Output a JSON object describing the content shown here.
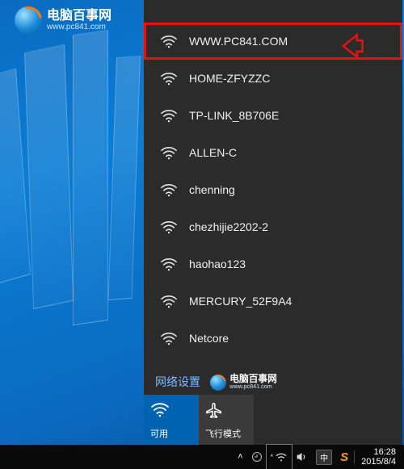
{
  "watermark": {
    "brand_cn": "电脑百事网",
    "brand_url": "www.pc841.com"
  },
  "wifi": {
    "networks": [
      {
        "name": "WWW.PC841.COM",
        "highlight": true
      },
      {
        "name": "HOME-ZFYZZC",
        "highlight": false
      },
      {
        "name": "TP-LINK_8B706E",
        "highlight": false
      },
      {
        "name": "ALLEN-C",
        "highlight": false
      },
      {
        "name": "chenning",
        "highlight": false
      },
      {
        "name": "chezhijie2202-2",
        "highlight": false
      },
      {
        "name": "haohao123",
        "highlight": false
      },
      {
        "name": "MERCURY_52F9A4",
        "highlight": false
      },
      {
        "name": "Netcore",
        "highlight": false
      }
    ],
    "settings_label": "网络设置",
    "tiles": {
      "wifi_label": "可用",
      "airplane_label": "飞行模式"
    }
  },
  "taskbar": {
    "ime_text": "中",
    "time": "16:28",
    "date": "2015/8/4"
  }
}
